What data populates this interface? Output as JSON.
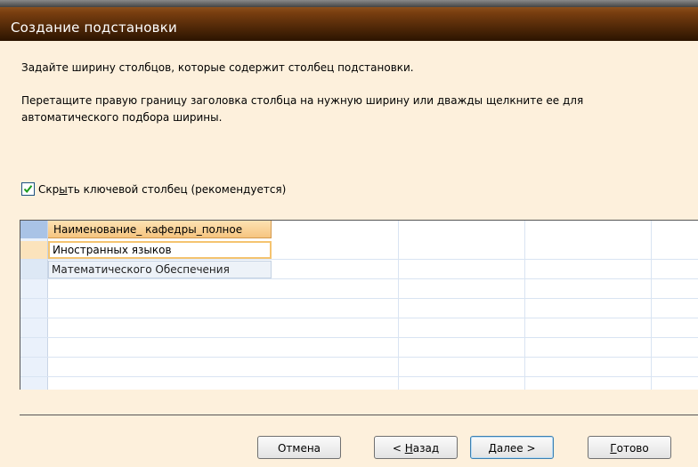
{
  "window": {
    "title": "Создание подстановки"
  },
  "instructions": {
    "line1": "Задайте ширину столбцов, которые содержит столбец подстановки.",
    "line2": "Перетащите правую границу заголовка столбца на нужную ширину или дважды щелкните ее для автоматического подбора ширины."
  },
  "hide_key": {
    "checked": true,
    "label_pre": "Скр",
    "label_u": "ы",
    "label_post": "ть ключевой столбец (рекомендуется)"
  },
  "grid": {
    "column_header": "Наименование_ кафедры_полное",
    "rows": [
      "Иностранных языков",
      "Математического Обеспечения"
    ]
  },
  "buttons": {
    "cancel": "Отмена",
    "back_pre": "< ",
    "back_u": "Н",
    "back_post": "азад",
    "next_u": "Д",
    "next_post": "алее >",
    "finish_u": "Г",
    "finish_post": "отово"
  }
}
